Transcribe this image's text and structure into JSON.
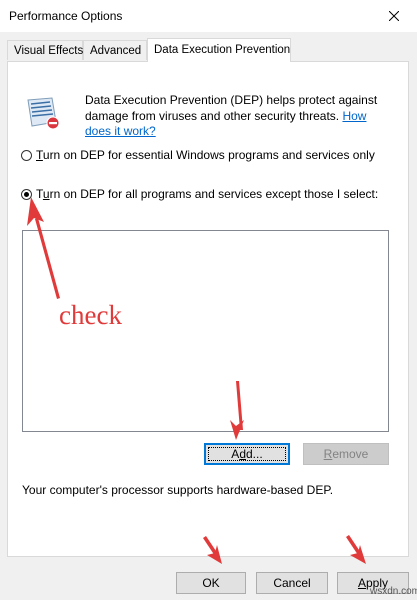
{
  "window": {
    "title": "Performance Options"
  },
  "tabs": [
    {
      "label": "Visual Effects",
      "active": false
    },
    {
      "label": "Advanced",
      "active": false
    },
    {
      "label": "Data Execution Prevention",
      "active": true
    }
  ],
  "description": {
    "text": "Data Execution Prevention (DEP) helps protect against damage from viruses and other security threats.",
    "link": "How does it work?"
  },
  "radios": [
    {
      "accel": "T",
      "rest": "urn on DEP for essential Windows programs and services only",
      "checked": false
    },
    {
      "accel": "u",
      "prefix": "T",
      "rest": "rn on DEP for all programs and services except those I select:",
      "checked": true
    }
  ],
  "buttons": {
    "add": {
      "accel": "d",
      "prefix": "A",
      "rest": "d..."
    },
    "remove": {
      "accel": "R",
      "rest": "emove",
      "disabled": true
    },
    "ok": "OK",
    "cancel": "Cancel",
    "apply": {
      "accel": "A",
      "rest": "pply"
    }
  },
  "support_text": "Your computer's processor supports hardware-based DEP.",
  "annotation": {
    "text": "check",
    "color": "#e03a3a"
  },
  "watermark": "wsxdn.com"
}
